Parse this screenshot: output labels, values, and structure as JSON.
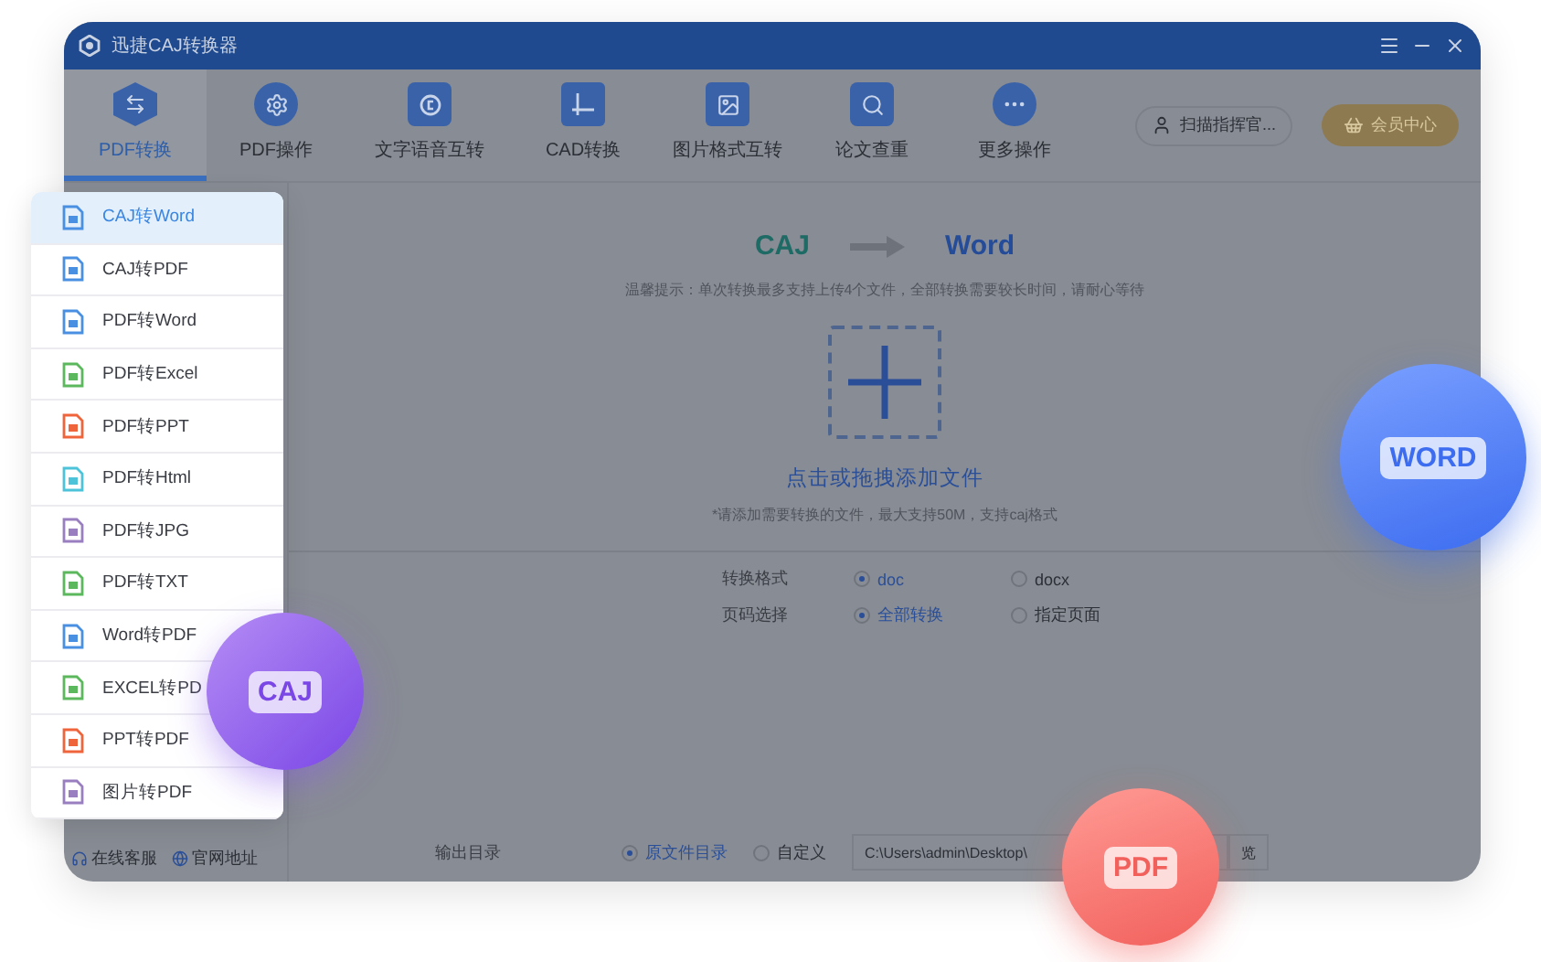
{
  "window": {
    "title": "迅捷CAJ转换器"
  },
  "toolbar": {
    "tabs": [
      {
        "label": "PDF转换",
        "kind": "hex",
        "selected": true
      },
      {
        "label": "PDF操作",
        "kind": "gear",
        "selected": false
      },
      {
        "label": "文字语音互转",
        "kind": "voice",
        "selected": false
      },
      {
        "label": "CAD转换",
        "kind": "cad",
        "selected": false
      },
      {
        "label": "图片格式互转",
        "kind": "image",
        "selected": false
      },
      {
        "label": "论文查重",
        "kind": "search",
        "selected": false
      },
      {
        "label": "更多操作",
        "kind": "more",
        "selected": false
      }
    ],
    "login": "扫描指挥官...",
    "vip": "会员中心"
  },
  "conversion": {
    "from": "CAJ",
    "to": "Word",
    "hint": "温馨提示：单次转换最多支持上传4个文件，全部转换需要较长时间，请耐心等待",
    "drop_label": "点击或拖拽添加文件",
    "drop_note": "*请添加需要转换的文件，最大支持50M，支持caj格式"
  },
  "options": [
    {
      "label": "转换格式",
      "choices": [
        {
          "label": "doc",
          "selected": true
        },
        {
          "label": "docx",
          "selected": false
        }
      ]
    },
    {
      "label": "页码选择",
      "choices": [
        {
          "label": "全部转换",
          "selected": true
        },
        {
          "label": "指定页面",
          "selected": false
        }
      ]
    }
  ],
  "output": {
    "label": "输出目录",
    "choices": [
      {
        "label": "原文件目录",
        "selected": true
      },
      {
        "label": "自定义",
        "selected": false
      }
    ],
    "path": "C:\\Users\\admin\\Desktop\\",
    "button": "览"
  },
  "sidebar_links": [
    {
      "label": "在线客服",
      "kind": "service"
    },
    {
      "label": "官网地址",
      "kind": "web"
    }
  ],
  "menu": [
    {
      "label": "CAJ转Word",
      "color": "#4a90e2",
      "selected": true
    },
    {
      "label": "CAJ转PDF",
      "color": "#4a90e2",
      "selected": false
    },
    {
      "label": "PDF转Word",
      "color": "#4a90e2",
      "selected": false
    },
    {
      "label": "PDF转Excel",
      "color": "#5cb85c",
      "selected": false
    },
    {
      "label": "PDF转PPT",
      "color": "#f0643c",
      "selected": false
    },
    {
      "label": "PDF转Html",
      "color": "#4cc3d9",
      "selected": false
    },
    {
      "label": "PDF转JPG",
      "color": "#9a7fc0",
      "selected": false
    },
    {
      "label": "PDF转TXT",
      "color": "#5cb85c",
      "selected": false
    },
    {
      "label": "Word转PDF",
      "color": "#4a90e2",
      "selected": false
    },
    {
      "label": "EXCEL转PD",
      "color": "#5cb85c",
      "selected": false
    },
    {
      "label": "PPT转PDF",
      "color": "#f0643c",
      "selected": false
    },
    {
      "label": "图片转PDF",
      "color": "#9a7fc0",
      "selected": false
    }
  ],
  "badges": [
    {
      "label": "CAJ",
      "kind": "caj"
    },
    {
      "label": "WORD",
      "kind": "word"
    },
    {
      "label": "PDF",
      "kind": "pdf"
    }
  ]
}
